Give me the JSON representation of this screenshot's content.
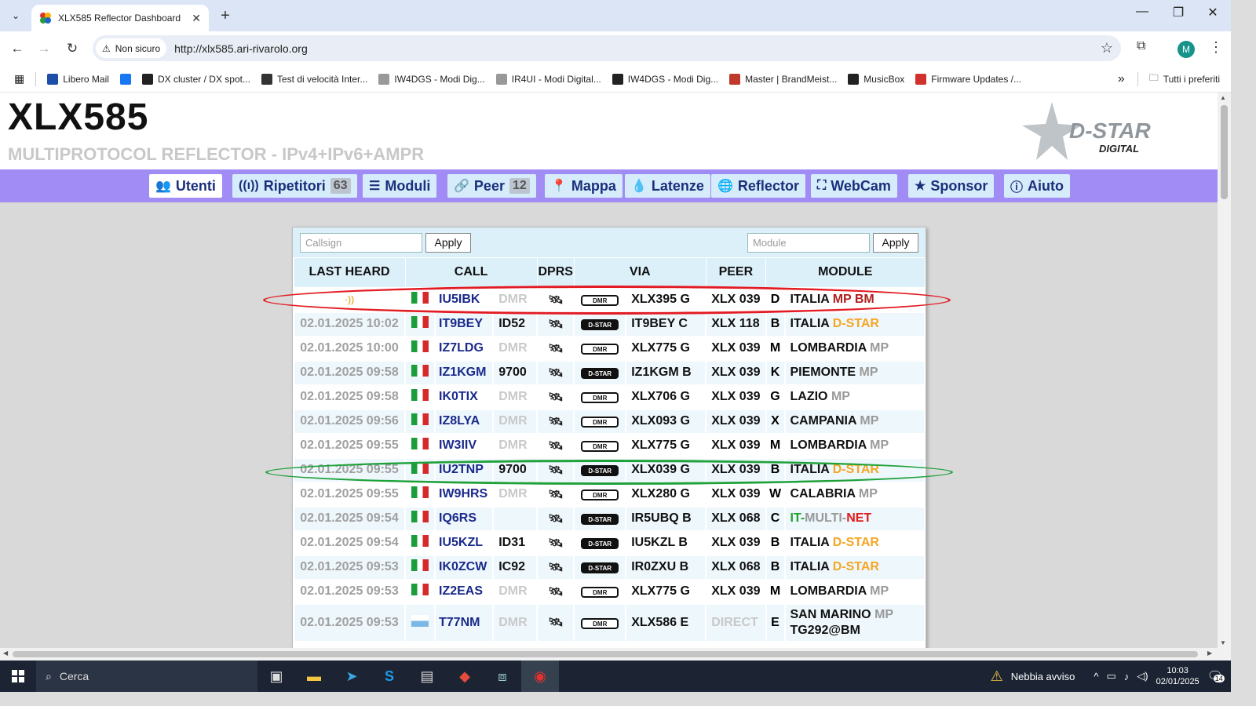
{
  "browser": {
    "tab_title": "XLX585 Reflector Dashboard",
    "security_label": "Non sicuro",
    "url": "http://xlx585.ari-rivarolo.org",
    "profile_initial": "M"
  },
  "bookmarks": [
    {
      "label": "Libero Mail",
      "icon": "libero-icon",
      "color": "#1e4fa8"
    },
    {
      "label": "",
      "icon": "facebook-icon",
      "color": "#1877f2"
    },
    {
      "label": "DX cluster / DX spot...",
      "icon": "dx-icon",
      "color": "#222222"
    },
    {
      "label": "Test di velocità Inter...",
      "icon": "speedtest-icon",
      "color": "#333333"
    },
    {
      "label": "IW4DGS - Modi Dig...",
      "icon": "antenna-icon",
      "color": "#999999"
    },
    {
      "label": "IR4UI - Modi Digital...",
      "icon": "antenna-icon",
      "color": "#999999"
    },
    {
      "label": "IW4DGS - Modi Dig...",
      "icon": "grid-icon",
      "color": "#222222"
    },
    {
      "label": "Master | BrandMeist...",
      "icon": "brandmeister-icon",
      "color": "#c0392b"
    },
    {
      "label": "MusicBox",
      "icon": "music-icon",
      "color": "#222222"
    },
    {
      "label": "Firmware Updates /...",
      "icon": "pin-icon",
      "color": "#d0312d"
    }
  ],
  "bookmarks_more": "»",
  "all_bookmarks": "Tutti i preferiti",
  "header": {
    "title": "XLX585",
    "subtitle": "MULTIPROTOCOL REFLECTOR - IPv4+IPv6+AMPR",
    "logo_text": "D-STAR",
    "logo_sub": "DIGITAL"
  },
  "menu": [
    {
      "label": "Utenti",
      "icon": "users-icon",
      "count": "",
      "active": true
    },
    {
      "label": "Ripetitori",
      "icon": "tower-icon",
      "count": "63",
      "active": false
    },
    {
      "label": "Moduli",
      "icon": "list-icon",
      "count": "",
      "active": false
    },
    {
      "label": "Peer",
      "icon": "link-icon",
      "count": "12",
      "active": false
    },
    {
      "label": "Mappa",
      "icon": "marker-icon",
      "count": "",
      "active": false
    },
    {
      "label": "Latenze",
      "icon": "drop-icon",
      "count": "",
      "active": false
    },
    {
      "label": "Reflector",
      "icon": "globe-icon",
      "count": "",
      "active": false
    },
    {
      "label": "WebCam",
      "icon": "binoculars-icon",
      "count": "",
      "active": false
    },
    {
      "label": "Sponsor",
      "icon": "star-icon",
      "count": "",
      "active": false
    },
    {
      "label": "Aiuto",
      "icon": "info-icon",
      "count": "",
      "active": false
    }
  ],
  "filters": {
    "callsign_placeholder": "Callsign",
    "module_placeholder": "Module",
    "apply": "Apply"
  },
  "table": {
    "headers": [
      "LAST HEARD",
      "CALL",
      "DPRS",
      "VIA",
      "PEER",
      "MODULE"
    ],
    "rows": [
      {
        "time": "",
        "live": true,
        "flag": "it",
        "call": "IU5IBK",
        "suffix": "DMR",
        "mode": "DMR",
        "via": "XLX395 G",
        "peer": "XLX 039",
        "mod": "D",
        "desc_a": "ITALIA",
        "desc_b": "MP BM",
        "style": "mpbm"
      },
      {
        "time": "02.01.2025 10:02",
        "flag": "it",
        "call": "IT9BEY",
        "suffix": "ID52",
        "mode": "D-STAR",
        "via": "IT9BEY C",
        "peer": "XLX 118",
        "mod": "B",
        "desc_a": "ITALIA",
        "desc_b": "D-STAR",
        "style": "ds"
      },
      {
        "time": "02.01.2025 10:00",
        "flag": "it",
        "call": "IZ7LDG",
        "suffix": "DMR",
        "mode": "DMR",
        "via": "XLX775 G",
        "peer": "XLX 039",
        "mod": "M",
        "desc_a": "LOMBARDIA",
        "desc_b": "MP",
        "style": "mp"
      },
      {
        "time": "02.01.2025 09:58",
        "flag": "it",
        "call": "IZ1KGM",
        "suffix": "9700",
        "mode": "D-STAR",
        "via": "IZ1KGM B",
        "peer": "XLX 039",
        "mod": "K",
        "desc_a": "PIEMONTE",
        "desc_b": "MP",
        "style": "mp"
      },
      {
        "time": "02.01.2025 09:58",
        "flag": "it",
        "call": "IK0TIX",
        "suffix": "DMR",
        "mode": "DMR",
        "via": "XLX706 G",
        "peer": "XLX 039",
        "mod": "G",
        "desc_a": "LAZIO",
        "desc_b": "MP",
        "style": "mp"
      },
      {
        "time": "02.01.2025 09:56",
        "flag": "it",
        "call": "IZ8LYA",
        "suffix": "DMR",
        "mode": "DMR",
        "via": "XLX093 G",
        "peer": "XLX 039",
        "mod": "X",
        "desc_a": "CAMPANIA",
        "desc_b": "MP",
        "style": "mp"
      },
      {
        "time": "02.01.2025 09:55",
        "flag": "it",
        "call": "IW3IIV",
        "suffix": "DMR",
        "mode": "DMR",
        "via": "XLX775 G",
        "peer": "XLX 039",
        "mod": "M",
        "desc_a": "LOMBARDIA",
        "desc_b": "MP",
        "style": "mp"
      },
      {
        "time": "02.01.2025 09:55",
        "flag": "it",
        "call": "IU2TNP",
        "suffix": "9700",
        "mode": "D-STAR",
        "via": "XLX039 G",
        "peer": "XLX 039",
        "mod": "B",
        "desc_a": "ITALIA",
        "desc_b": "D-STAR",
        "style": "ds"
      },
      {
        "time": "02.01.2025 09:55",
        "flag": "it",
        "call": "IW9HRS",
        "suffix": "DMR",
        "mode": "DMR",
        "via": "XLX280 G",
        "peer": "XLX 039",
        "mod": "W",
        "desc_a": "CALABRIA",
        "desc_b": "MP",
        "style": "mp"
      },
      {
        "time": "02.01.2025 09:54",
        "flag": "it",
        "call": "IQ6RS",
        "suffix": "",
        "mode": "D-STAR",
        "via": "IR5UBQ B",
        "peer": "XLX 068",
        "mod": "C",
        "desc_a": "IT-",
        "desc_b": "MULTI-",
        "desc_c": "NET",
        "style": "multi"
      },
      {
        "time": "02.01.2025 09:54",
        "flag": "it",
        "call": "IU5KZL",
        "suffix": "ID31",
        "mode": "D-STAR",
        "via": "IU5KZL B",
        "peer": "XLX 039",
        "mod": "B",
        "desc_a": "ITALIA",
        "desc_b": "D-STAR",
        "style": "ds"
      },
      {
        "time": "02.01.2025 09:53",
        "flag": "it",
        "call": "IK0ZCW",
        "suffix": "IC92",
        "mode": "D-STAR",
        "via": "IR0ZXU B",
        "peer": "XLX 068",
        "mod": "B",
        "desc_a": "ITALIA",
        "desc_b": "D-STAR",
        "style": "ds"
      },
      {
        "time": "02.01.2025 09:53",
        "flag": "it",
        "call": "IZ2EAS",
        "suffix": "DMR",
        "mode": "DMR",
        "via": "XLX775 G",
        "peer": "XLX 039",
        "mod": "M",
        "desc_a": "LOMBARDIA",
        "desc_b": "MP",
        "style": "mp"
      },
      {
        "time": "02.01.2025 09:53",
        "flag": "sm",
        "call": "T77NM",
        "suffix": "DMR",
        "mode": "DMR",
        "via": "XLX586 E",
        "peer": "DIRECT",
        "mod": "E",
        "desc_a": "SAN MARINO",
        "desc_b": "MP",
        "desc_c": "TG292@BM",
        "style": "sm"
      }
    ]
  },
  "taskbar": {
    "search": "Cerca",
    "weather": "Nebbia avviso",
    "time": "10:03",
    "date": "02/01/2025",
    "notifications": "14"
  }
}
